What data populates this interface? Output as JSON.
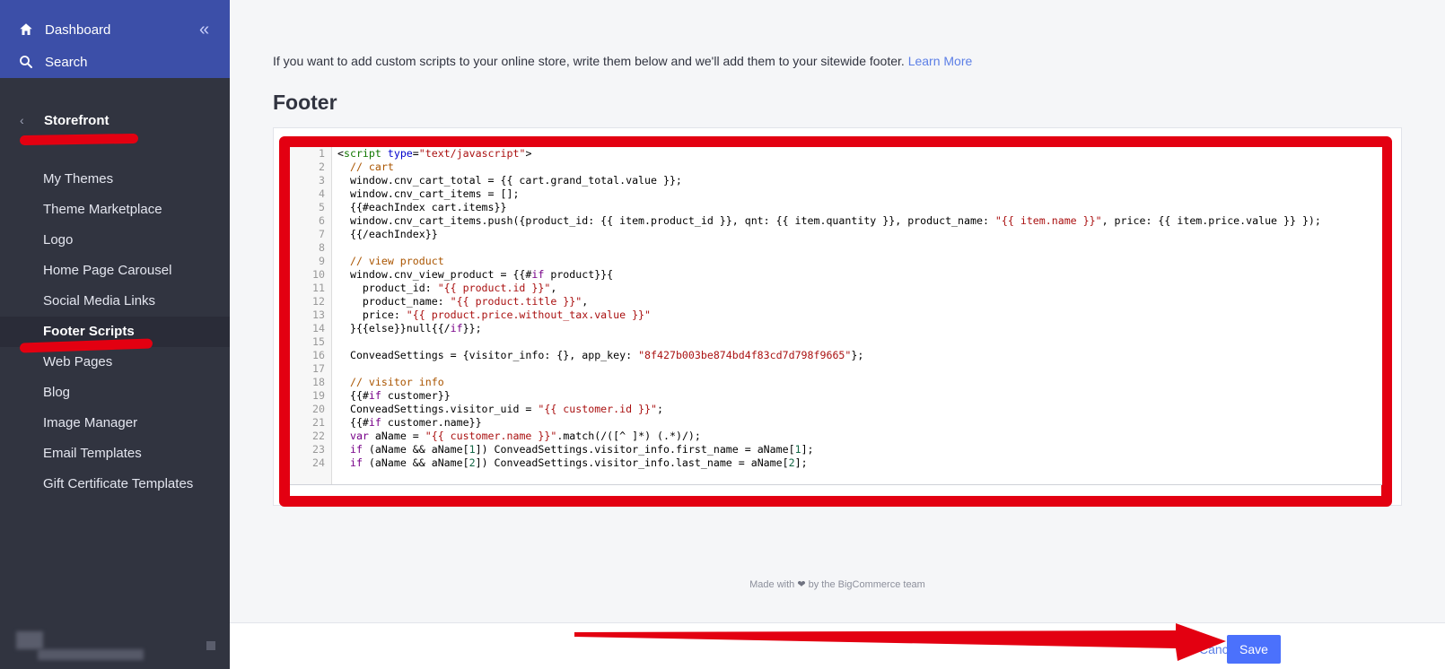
{
  "sidebar": {
    "dashboard_label": "Dashboard",
    "search_label": "Search",
    "collapse_glyph": "«",
    "back_glyph": "‹",
    "section_title": "Storefront",
    "items": [
      {
        "label": "My Themes"
      },
      {
        "label": "Theme Marketplace"
      },
      {
        "label": "Logo"
      },
      {
        "label": "Home Page Carousel"
      },
      {
        "label": "Social Media Links"
      },
      {
        "label": "Footer Scripts"
      },
      {
        "label": "Web Pages"
      },
      {
        "label": "Blog"
      },
      {
        "label": "Image Manager"
      },
      {
        "label": "Email Templates"
      },
      {
        "label": "Gift Certificate Templates"
      }
    ],
    "active_item": "Footer Scripts"
  },
  "main": {
    "intro_text": "If you want to add custom scripts to your online store, write them below and we'll add them to your sitewide footer.",
    "learn_more": "Learn More",
    "heading": "Footer",
    "code_lines": [
      {
        "n": "1",
        "text": "<script type=\"text/javascript\">"
      },
      {
        "n": "2",
        "text": "  // cart"
      },
      {
        "n": "3",
        "text": "  window.cnv_cart_total = {{ cart.grand_total.value }};"
      },
      {
        "n": "4",
        "text": "  window.cnv_cart_items = [];"
      },
      {
        "n": "5",
        "text": "  {{#eachIndex cart.items}}"
      },
      {
        "n": "6",
        "text": "  window.cnv_cart_items.push({product_id: {{ item.product_id }}, qnt: {{ item.quantity }}, product_name: \"{{ item.name }}\", price: {{ item.price.value }} });"
      },
      {
        "n": "7",
        "text": "  {{/eachIndex}}"
      },
      {
        "n": "8",
        "text": ""
      },
      {
        "n": "9",
        "text": "  // view product"
      },
      {
        "n": "10",
        "text": "  window.cnv_view_product = {{#if product}}{"
      },
      {
        "n": "11",
        "text": "    product_id: \"{{ product.id }}\","
      },
      {
        "n": "12",
        "text": "    product_name: \"{{ product.title }}\","
      },
      {
        "n": "13",
        "text": "    price: \"{{ product.price.without_tax.value }}\""
      },
      {
        "n": "14",
        "text": "  }{{else}}null{{/if}};"
      },
      {
        "n": "15",
        "text": ""
      },
      {
        "n": "16",
        "text": "  ConveadSettings = {visitor_info: {}, app_key: \"8f427b003be874bd4f83cd7d798f9665\"};"
      },
      {
        "n": "17",
        "text": ""
      },
      {
        "n": "18",
        "text": "  // visitor info"
      },
      {
        "n": "19",
        "text": "  {{#if customer}}"
      },
      {
        "n": "20",
        "text": "  ConveadSettings.visitor_uid = \"{{ customer.id }}\";"
      },
      {
        "n": "21",
        "text": "  {{#if customer.name}}"
      },
      {
        "n": "22",
        "text": "  var aName = \"{{ customer.name }}\".match(/([^ ]*) (.*)/);"
      },
      {
        "n": "23",
        "text": "  if (aName && aName[1]) ConveadSettings.visitor_info.first_name = aName[1];"
      },
      {
        "n": "24",
        "text": "  if (aName && aName[2]) ConveadSettings.visitor_info.last_name = aName[2];"
      }
    ]
  },
  "footer": {
    "made_with": "Made with",
    "heart_glyph": "❤",
    "by_team": "by the BigCommerce team"
  },
  "actions": {
    "cancel_label": "Cancel",
    "save_label": "Save"
  },
  "colors": {
    "sidebar_bg": "#313440",
    "sidebar_top_bg": "#3c4fa8",
    "annotation_red": "#e30011",
    "accent_blue": "#4b71fc",
    "link_blue": "#5c7fe6"
  }
}
